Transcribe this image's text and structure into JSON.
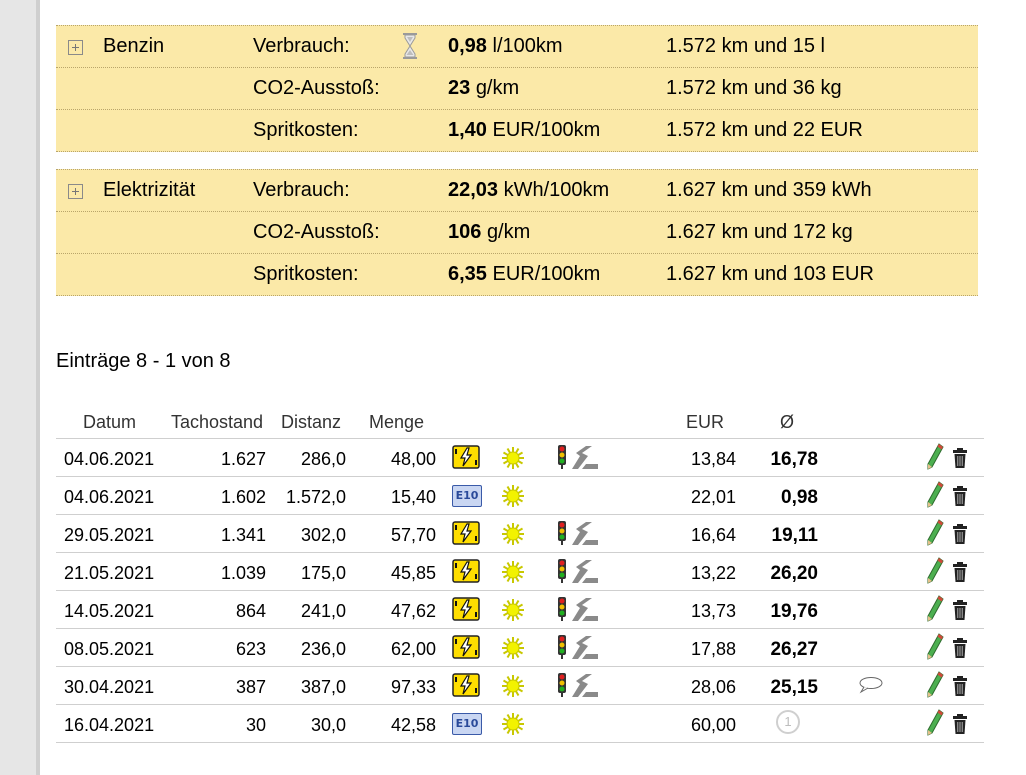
{
  "fuels": [
    {
      "name": "Benzin",
      "rows": [
        {
          "label": "Verbrauch:",
          "value": "0,98",
          "unit": "l/100km",
          "total": "1.572 km und 15 l"
        },
        {
          "label": "CO2-Ausstoß:",
          "value": "23",
          "unit": "g/km",
          "total": "1.572 km und 36 kg"
        },
        {
          "label": "Spritkosten:",
          "value": "1,40",
          "unit": "EUR/100km",
          "total": "1.572 km und 22 EUR"
        }
      ]
    },
    {
      "name": "Elektrizität",
      "rows": [
        {
          "label": "Verbrauch:",
          "value": "22,03",
          "unit": "kWh/100km",
          "total": "1.627 km und 359 kWh"
        },
        {
          "label": "CO2-Ausstoß:",
          "value": "106",
          "unit": "g/km",
          "total": "1.627 km und 172 kg"
        },
        {
          "label": "Spritkosten:",
          "value": "6,35",
          "unit": "EUR/100km",
          "total": "1.627 km und 103 EUR"
        }
      ]
    }
  ],
  "entries_heading": "Einträge 8 - 1 von 8",
  "table": {
    "headers": {
      "date": "Datum",
      "odometer": "Tachostand",
      "distance": "Distanz",
      "amount": "Menge",
      "eur": "EUR",
      "avg": "Ø"
    },
    "rows": [
      {
        "date": "04.06.2021",
        "odometer": "1.627",
        "distance": "286,0",
        "amount": "48,00",
        "fuel": "electric",
        "eur": "13,84",
        "avg": "16,78",
        "comment": false,
        "badge": ""
      },
      {
        "date": "04.06.2021",
        "odometer": "1.602",
        "distance": "1.572,0",
        "amount": "15,40",
        "fuel": "E10",
        "eur": "22,01",
        "avg": "0,98",
        "comment": false,
        "badge": ""
      },
      {
        "date": "29.05.2021",
        "odometer": "1.341",
        "distance": "302,0",
        "amount": "57,70",
        "fuel": "electric",
        "eur": "16,64",
        "avg": "19,11",
        "comment": false,
        "badge": ""
      },
      {
        "date": "21.05.2021",
        "odometer": "1.039",
        "distance": "175,0",
        "amount": "45,85",
        "fuel": "electric",
        "eur": "13,22",
        "avg": "26,20",
        "comment": false,
        "badge": ""
      },
      {
        "date": "14.05.2021",
        "odometer": "864",
        "distance": "241,0",
        "amount": "47,62",
        "fuel": "electric",
        "eur": "13,73",
        "avg": "19,76",
        "comment": false,
        "badge": ""
      },
      {
        "date": "08.05.2021",
        "odometer": "623",
        "distance": "236,0",
        "amount": "62,00",
        "fuel": "electric",
        "eur": "17,88",
        "avg": "26,27",
        "comment": false,
        "badge": ""
      },
      {
        "date": "30.04.2021",
        "odometer": "387",
        "distance": "387,0",
        "amount": "97,33",
        "fuel": "electric",
        "eur": "28,06",
        "avg": "25,15",
        "comment": true,
        "badge": ""
      },
      {
        "date": "16.04.2021",
        "odometer": "30",
        "distance": "30,0",
        "amount": "42,58",
        "fuel": "E10",
        "eur": "60,00",
        "avg": "",
        "comment": false,
        "badge": "1"
      }
    ]
  },
  "icons": {
    "expand": "plus-box-icon",
    "hourglass": "hourglass-icon",
    "electric": "lightning-icon",
    "E10": "e10-fuel-icon",
    "sun": "sun-icon",
    "road": "traffic-light-road-icon",
    "comment": "speech-bubble-icon",
    "edit": "pencil-icon",
    "delete": "trash-icon"
  },
  "e10_label": "E10",
  "colors": {
    "summary_bg": "#fbe9a8",
    "electric_yellow": "#ffde00",
    "sun_yellow": "#f2f200"
  }
}
